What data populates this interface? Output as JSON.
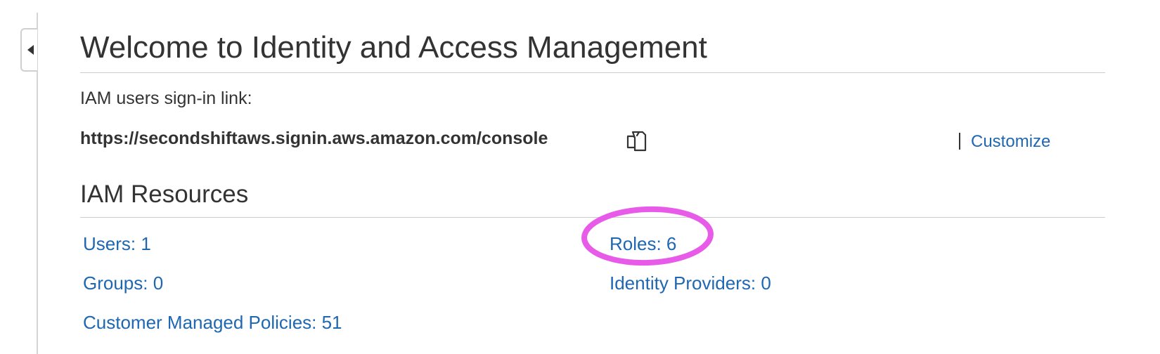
{
  "header": {
    "title": "Welcome to Identity and Access Management"
  },
  "signin": {
    "label": "IAM users sign-in link:",
    "url": "https://secondshiftaws.signin.aws.amazon.com/console",
    "customize_label": "Customize"
  },
  "resources": {
    "heading": "IAM Resources",
    "users": "Users: 1",
    "groups": "Groups: 0",
    "policies": "Customer Managed Policies: 51",
    "roles": "Roles: 6",
    "identity_providers": "Identity Providers: 0"
  },
  "icons": {
    "collapse": "chevron-left-icon",
    "copy": "copy-icon"
  },
  "colors": {
    "link": "#1f67b1",
    "text": "#333333",
    "annotation": "#e85ae8"
  }
}
